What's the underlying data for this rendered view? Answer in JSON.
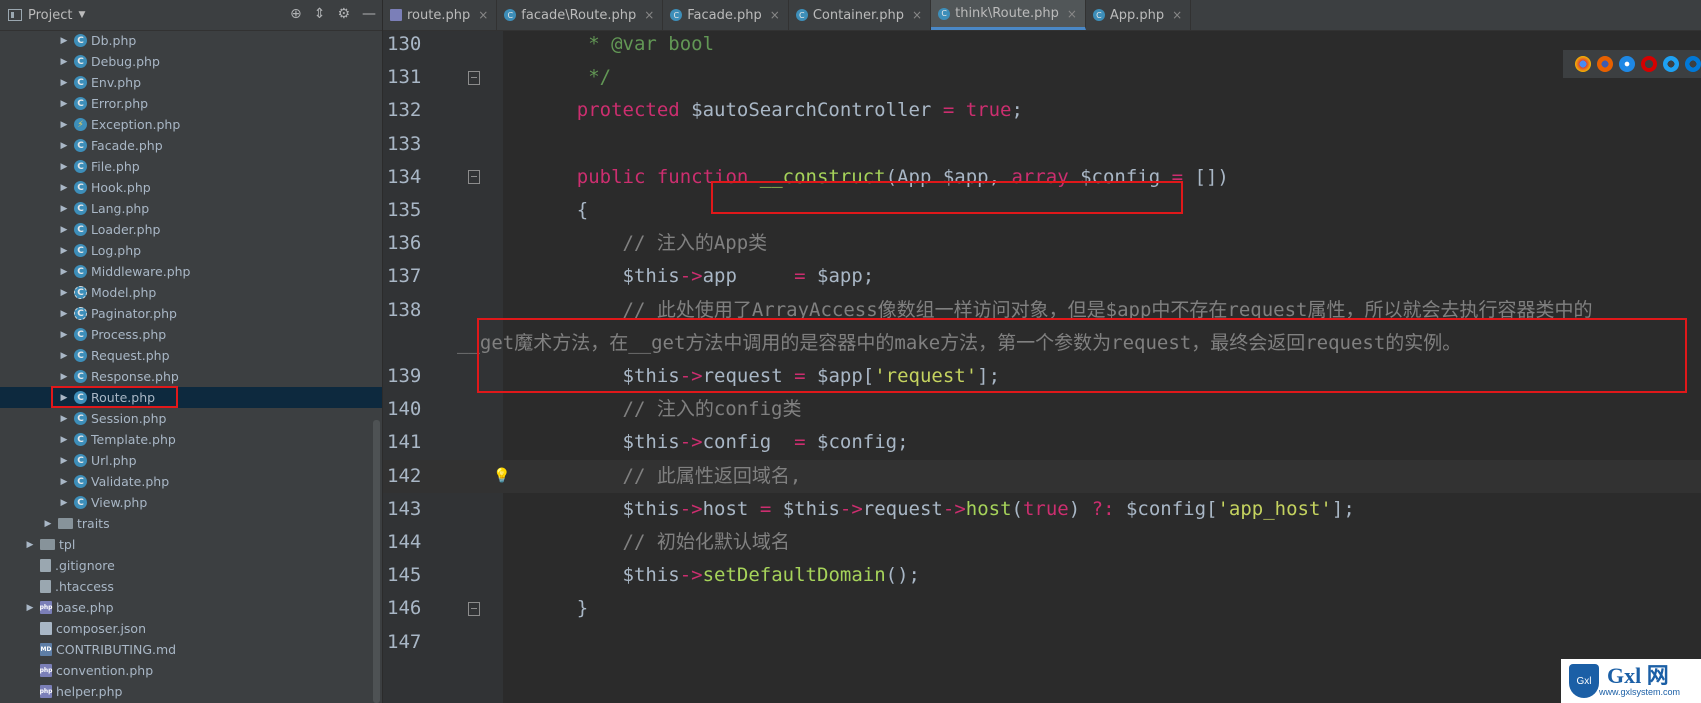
{
  "project": {
    "title": "Project",
    "tree": [
      {
        "indent": 70,
        "arrow": "▶",
        "icon": "class",
        "label": "Db.php"
      },
      {
        "indent": 70,
        "arrow": "▶",
        "icon": "class",
        "label": "Debug.php"
      },
      {
        "indent": 70,
        "arrow": "▶",
        "icon": "class",
        "label": "Env.php"
      },
      {
        "indent": 70,
        "arrow": "▶",
        "icon": "class",
        "label": "Error.php"
      },
      {
        "indent": 70,
        "arrow": "▶",
        "icon": "exception",
        "label": "Exception.php"
      },
      {
        "indent": 70,
        "arrow": "▶",
        "icon": "class",
        "label": "Facade.php"
      },
      {
        "indent": 70,
        "arrow": "▶",
        "icon": "class",
        "label": "File.php"
      },
      {
        "indent": 70,
        "arrow": "▶",
        "icon": "class",
        "label": "Hook.php"
      },
      {
        "indent": 70,
        "arrow": "▶",
        "icon": "class",
        "label": "Lang.php"
      },
      {
        "indent": 70,
        "arrow": "▶",
        "icon": "class",
        "label": "Loader.php"
      },
      {
        "indent": 70,
        "arrow": "▶",
        "icon": "class",
        "label": "Log.php"
      },
      {
        "indent": 70,
        "arrow": "▶",
        "icon": "class",
        "label": "Middleware.php"
      },
      {
        "indent": 70,
        "arrow": "▶",
        "icon": "abstract",
        "label": "Model.php"
      },
      {
        "indent": 70,
        "arrow": "▶",
        "icon": "abstract",
        "label": "Paginator.php"
      },
      {
        "indent": 70,
        "arrow": "▶",
        "icon": "class",
        "label": "Process.php"
      },
      {
        "indent": 70,
        "arrow": "▶",
        "icon": "class",
        "label": "Request.php"
      },
      {
        "indent": 70,
        "arrow": "▶",
        "icon": "class",
        "label": "Response.php"
      },
      {
        "indent": 70,
        "arrow": "▶",
        "icon": "class",
        "label": "Route.php",
        "selected": true
      },
      {
        "indent": 70,
        "arrow": "▶",
        "icon": "class",
        "label": "Session.php"
      },
      {
        "indent": 70,
        "arrow": "▶",
        "icon": "class",
        "label": "Template.php"
      },
      {
        "indent": 70,
        "arrow": "▶",
        "icon": "class",
        "label": "Url.php"
      },
      {
        "indent": 70,
        "arrow": "▶",
        "icon": "class",
        "label": "Validate.php"
      },
      {
        "indent": 70,
        "arrow": "▶",
        "icon": "class",
        "label": "View.php"
      },
      {
        "indent": 54,
        "arrow": "▶",
        "icon": "folder",
        "label": "traits"
      },
      {
        "indent": 36,
        "arrow": "▶",
        "icon": "folder",
        "label": "tpl"
      },
      {
        "indent": 36,
        "arrow": "",
        "icon": "file",
        "label": ".gitignore"
      },
      {
        "indent": 36,
        "arrow": "",
        "icon": "file",
        "label": ".htaccess"
      },
      {
        "indent": 36,
        "arrow": "▶",
        "icon": "phpfile",
        "label": "base.php"
      },
      {
        "indent": 36,
        "arrow": "",
        "icon": "json",
        "label": "composer.json"
      },
      {
        "indent": 36,
        "arrow": "",
        "icon": "md",
        "label": "CONTRIBUTING.md"
      },
      {
        "indent": 36,
        "arrow": "",
        "icon": "phpfile",
        "label": "convention.php"
      },
      {
        "indent": 36,
        "arrow": "",
        "icon": "phpfile",
        "label": "helper.php"
      }
    ]
  },
  "tabs": [
    {
      "label": "route.php",
      "icon": "php"
    },
    {
      "label": "facade\\Route.php",
      "icon": "class"
    },
    {
      "label": "Facade.php",
      "icon": "class"
    },
    {
      "label": "Container.php",
      "icon": "class"
    },
    {
      "label": "think\\Route.php",
      "icon": "class",
      "active": true
    },
    {
      "label": "App.php",
      "icon": "class"
    }
  ],
  "editor": {
    "lines": [
      {
        "num": "130",
        "parts": [
          [
            "doc",
            "     * @var bool"
          ]
        ]
      },
      {
        "num": "131",
        "parts": [
          [
            "doc",
            "     */"
          ]
        ],
        "fold": true
      },
      {
        "num": "132",
        "parts": [
          [
            "kw2",
            "    protected "
          ],
          [
            "var",
            "$autoSearchController "
          ],
          [
            "kw2",
            "= "
          ],
          [
            "kw2",
            "true"
          ],
          [
            "var",
            ";"
          ]
        ]
      },
      {
        "num": "133",
        "parts": []
      },
      {
        "num": "134",
        "parts": [
          [
            "kw2",
            "    public function "
          ],
          [
            "fn2",
            "__construct"
          ],
          [
            "var",
            "(App $app, "
          ],
          [
            "kw2",
            "array "
          ],
          [
            "var",
            "$config "
          ],
          [
            "kw2",
            "= "
          ],
          [
            "var",
            "[])"
          ]
        ],
        "fold": true
      },
      {
        "num": "135",
        "parts": [
          [
            "var",
            "    {"
          ]
        ]
      },
      {
        "num": "136",
        "parts": [
          [
            "cm",
            "        // 注入的App类"
          ]
        ]
      },
      {
        "num": "137",
        "parts": [
          [
            "var",
            "        $this"
          ],
          [
            "arrowop",
            "->"
          ],
          [
            "var",
            "app     "
          ],
          [
            "kw2",
            "= "
          ],
          [
            "var",
            "$app;"
          ]
        ]
      },
      {
        "num": "138",
        "parts": [
          [
            "cm",
            "        // 此处使用了ArrayAccess像数组一样访问对象，但是$app中不存在request属性，所以就会去执行容器类中的"
          ]
        ]
      },
      {
        "num": "",
        "parts": [
          [
            "cm",
            "__get魔术方法，在__get方法中调用的是容器中的make方法，第一个参数为request，最终会返回request的实例。"
          ]
        ],
        "wrap": true
      },
      {
        "num": "139",
        "parts": [
          [
            "var",
            "        $this"
          ],
          [
            "arrowop",
            "->"
          ],
          [
            "var",
            "request "
          ],
          [
            "kw2",
            "= "
          ],
          [
            "var",
            "$app["
          ],
          [
            "str",
            "'request'"
          ],
          [
            "var",
            "];"
          ]
        ]
      },
      {
        "num": "140",
        "parts": [
          [
            "cm",
            "        // 注入的config类"
          ]
        ]
      },
      {
        "num": "141",
        "parts": [
          [
            "var",
            "        $this"
          ],
          [
            "arrowop",
            "->"
          ],
          [
            "var",
            "config  "
          ],
          [
            "kw2",
            "= "
          ],
          [
            "var",
            "$config;"
          ]
        ]
      },
      {
        "num": "142",
        "parts": [
          [
            "cm",
            "        // 此属性返回域名,"
          ]
        ],
        "current": true,
        "bulb": true
      },
      {
        "num": "143",
        "parts": [
          [
            "var",
            "        $this"
          ],
          [
            "arrowop",
            "->"
          ],
          [
            "var",
            "host "
          ],
          [
            "kw2",
            "= "
          ],
          [
            "var",
            "$this"
          ],
          [
            "arrowop",
            "->"
          ],
          [
            "var",
            "request"
          ],
          [
            "arrowop",
            "->"
          ],
          [
            "fn2",
            "host"
          ],
          [
            "var",
            "("
          ],
          [
            "kw2",
            "true"
          ],
          [
            "var",
            ") "
          ],
          [
            "kw2",
            "?: "
          ],
          [
            "var",
            "$config["
          ],
          [
            "str",
            "'app_host'"
          ],
          [
            "var",
            "];"
          ]
        ]
      },
      {
        "num": "144",
        "parts": [
          [
            "cm",
            "        // 初始化默认域名"
          ]
        ]
      },
      {
        "num": "145",
        "parts": [
          [
            "var",
            "        $this"
          ],
          [
            "arrowop",
            "->"
          ],
          [
            "fn2",
            "setDefaultDomain"
          ],
          [
            "var",
            "();"
          ]
        ]
      },
      {
        "num": "146",
        "parts": [
          [
            "var",
            "    }"
          ]
        ],
        "fold": true
      },
      {
        "num": "147",
        "parts": []
      }
    ]
  },
  "watermark": {
    "logo": "Gxl",
    "text": "Gxl 网",
    "sub": "www.gxlsystem.com"
  },
  "colors": {
    "highlight": "#e0181a",
    "selection": "#0d293e",
    "tab_active": "#515658"
  }
}
